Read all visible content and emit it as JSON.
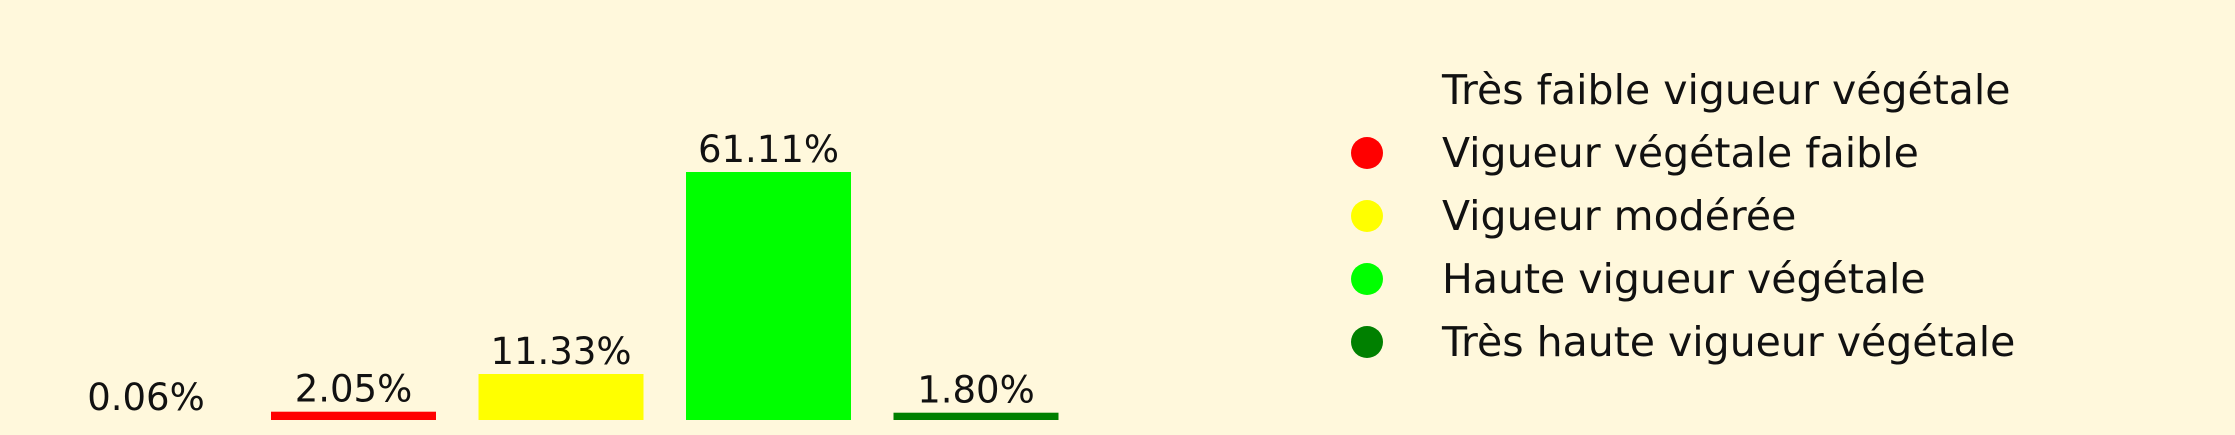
{
  "chart_data": {
    "type": "bar",
    "title": "",
    "xlabel": "",
    "ylabel": "",
    "ylim": [
      0,
      61.11
    ],
    "grid": false,
    "legend_position": "right",
    "categories": [
      "Très faible vigueur végétale",
      "Vigueur végétale faible",
      "Vigueur modérée",
      "Haute vigueur végétale",
      "Très haute vigueur végétale"
    ],
    "values": [
      0.06,
      2.05,
      11.33,
      61.11,
      1.8
    ],
    "value_labels": [
      "0.06%",
      "2.05%",
      "11.33%",
      "61.11%",
      "1.80%"
    ],
    "colors": [
      "#fff8dc",
      "#ff0000",
      "#ffff00",
      "#00ff00",
      "#008000"
    ],
    "legend": [
      {
        "label": "Très faible vigueur végétale",
        "color": "#fff8dc"
      },
      {
        "label": "Vigueur végétale faible",
        "color": "#ff0000"
      },
      {
        "label": "Vigueur modérée",
        "color": "#ffff00"
      },
      {
        "label": "Haute vigueur végétale",
        "color": "#00ff00"
      },
      {
        "label": "Très haute vigueur végétale",
        "color": "#008000"
      }
    ]
  }
}
